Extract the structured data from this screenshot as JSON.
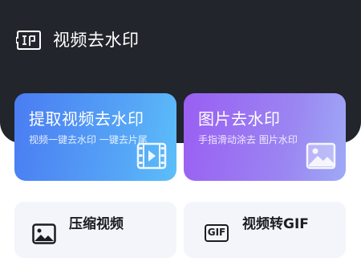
{
  "header": {
    "title": "视频去水印",
    "logo_icon": "watermark-stamp-icon",
    "background": "#22252c"
  },
  "cards": [
    {
      "title": "提取视频去水印",
      "desc": "视频一键去水印 一键去片尾",
      "icon": "video-film-icon",
      "gradient": [
        "#4a7cf2",
        "#5cbff8"
      ]
    },
    {
      "title": "图片去水印",
      "desc": "手指滑动涂去 图片水印",
      "icon": "image-picture-icon",
      "gradient": [
        "#9a5ef3",
        "#9eaaf6"
      ]
    }
  ],
  "tools": [
    {
      "title": "压缩视频",
      "icon": "image-picture-icon"
    },
    {
      "title": "视频转GIF",
      "icon": "gif-icon",
      "icon_text": "GIF"
    }
  ]
}
